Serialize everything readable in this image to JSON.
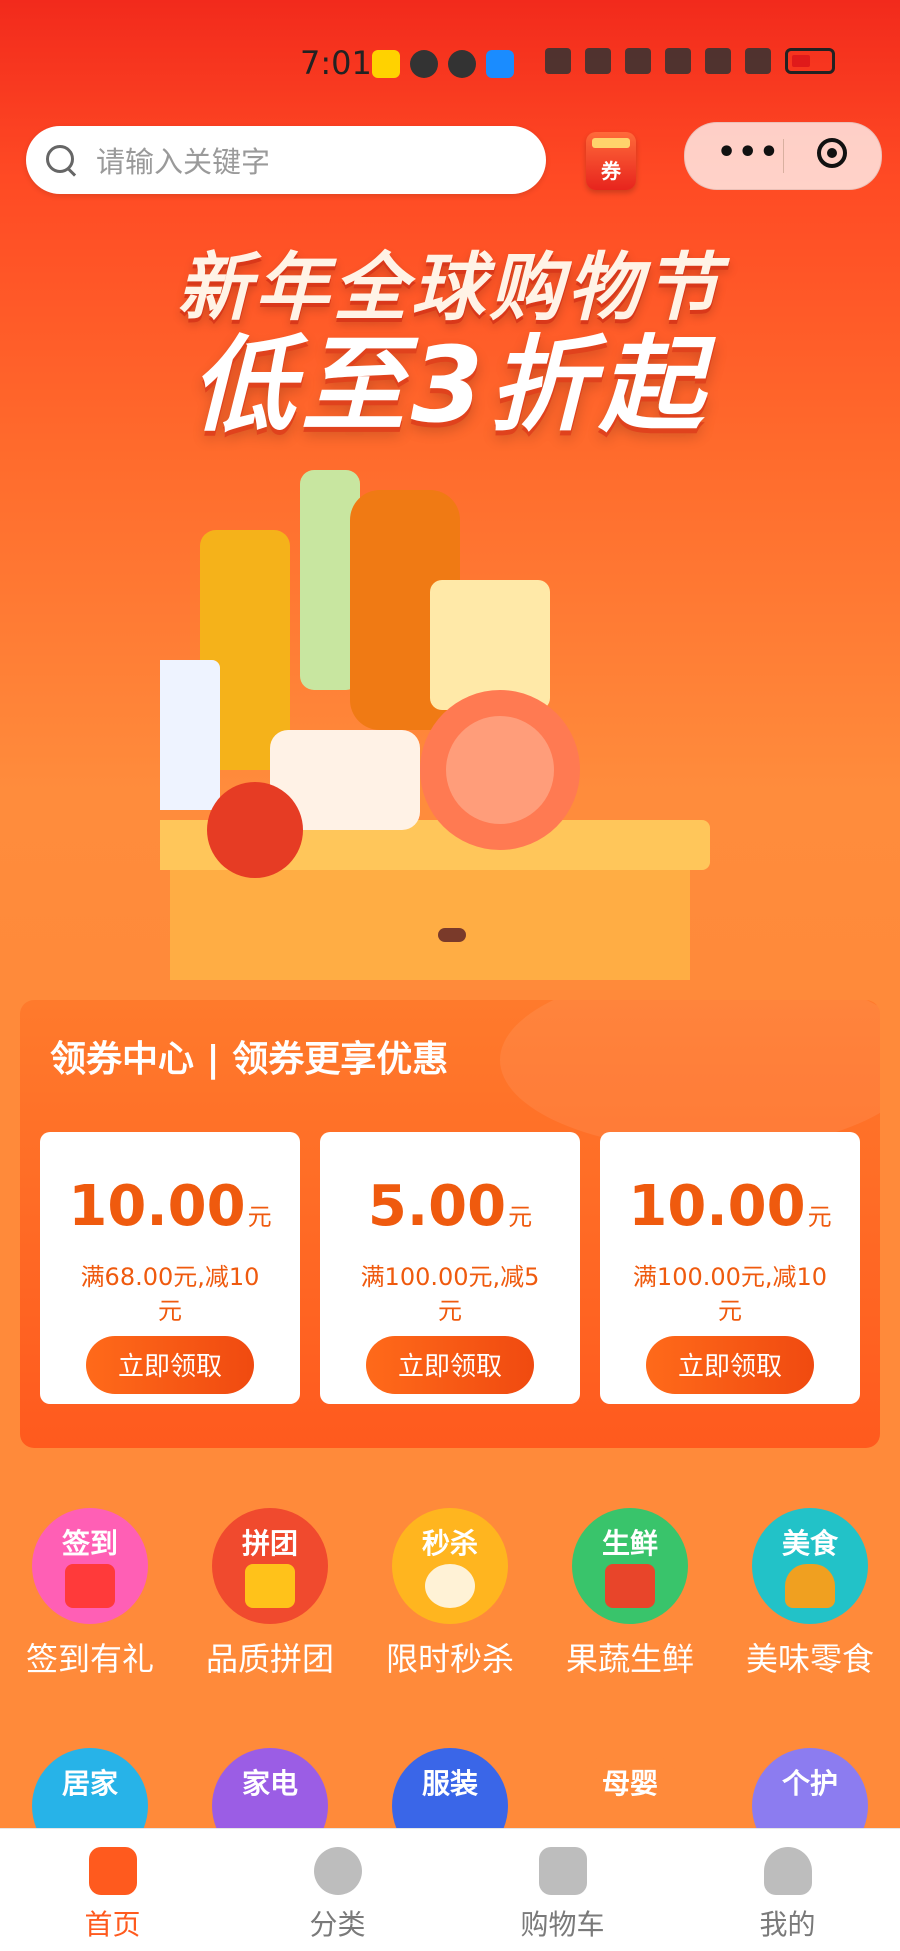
{
  "status_bar": {
    "time": "7:01"
  },
  "search": {
    "placeholder": "请输入关键字"
  },
  "coupon_button": {
    "label": "券"
  },
  "banner": {
    "line1": "新年全球购物节",
    "line2": "低至3折起"
  },
  "coupon_center": {
    "title": "领券中心 | 领券更享优惠",
    "coupons": [
      {
        "amount": "10.00",
        "unit": "元",
        "condition": "满68.00元,减10元",
        "button": "立即领取"
      },
      {
        "amount": "5.00",
        "unit": "元",
        "condition": "满100.00元,减5元",
        "button": "立即领取"
      },
      {
        "amount": "10.00",
        "unit": "元",
        "condition": "满100.00元,减10元",
        "button": "立即领取"
      }
    ]
  },
  "categories_row1": [
    {
      "badge": "签到",
      "label": "签到有礼",
      "color": "#ff5fb5"
    },
    {
      "badge": "拼团",
      "label": "品质拼团",
      "color": "#f04a2e"
    },
    {
      "badge": "秒杀",
      "label": "限时秒杀",
      "color": "#ffb51f"
    },
    {
      "badge": "生鲜",
      "label": "果蔬生鲜",
      "color": "#39c46b"
    },
    {
      "badge": "美食",
      "label": "美味零食",
      "color": "#22c2c8"
    }
  ],
  "categories_row2": [
    {
      "badge": "居家",
      "color": "#27b3e8"
    },
    {
      "badge": "家电",
      "color": "#9b5de5"
    },
    {
      "badge": "服装",
      "color": "#3a66e8"
    },
    {
      "badge": "母婴",
      "color": "#ff8a3a"
    },
    {
      "badge": "个护",
      "color": "#8c7cf0"
    }
  ],
  "tabbar": [
    {
      "label": "首页",
      "icon": "home-icon",
      "active": true
    },
    {
      "label": "分类",
      "icon": "category-icon",
      "active": false
    },
    {
      "label": "购物车",
      "icon": "cart-icon",
      "active": false
    },
    {
      "label": "我的",
      "icon": "profile-icon",
      "active": false
    }
  ]
}
